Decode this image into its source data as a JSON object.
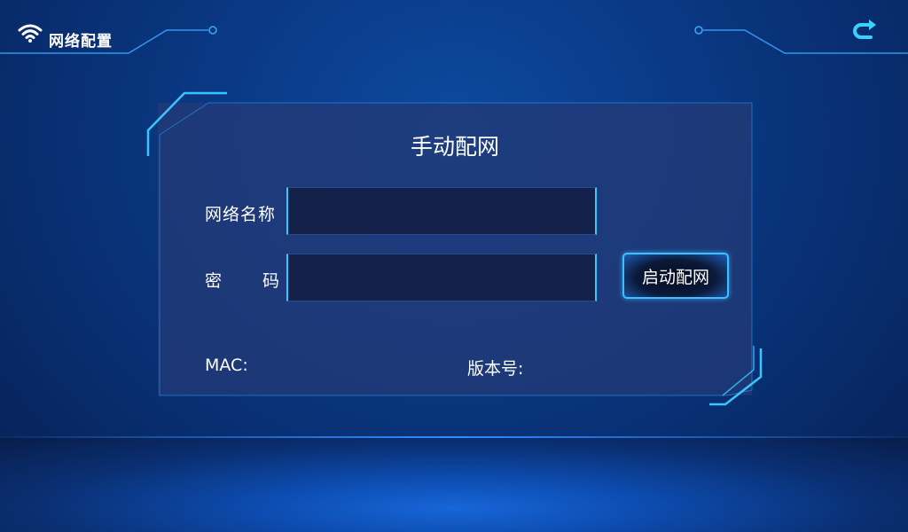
{
  "header": {
    "title": "网络配置",
    "left_icon": "wifi-icon",
    "right_icon": "back-arrow-icon"
  },
  "panel": {
    "title": "手动配网",
    "ssid": {
      "label": "网络名称",
      "value": "",
      "placeholder": ""
    },
    "password": {
      "label_chars": [
        "密",
        "码"
      ],
      "value": "",
      "placeholder": ""
    },
    "start_button": "启动配网",
    "mac_label": "MAC:",
    "version_label": "版本号:"
  },
  "colors": {
    "accent": "#37c8ff",
    "background": "#0a3a86",
    "panel": "#223a76",
    "input_bg": "#14214a"
  }
}
